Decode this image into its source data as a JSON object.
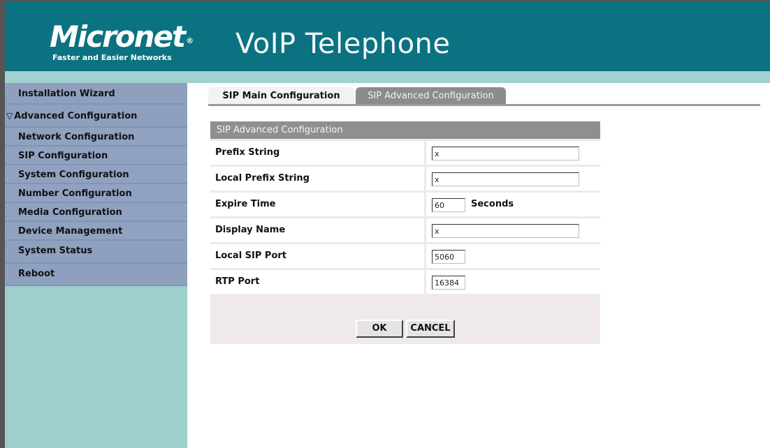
{
  "header": {
    "logo_text": "Micronet",
    "logo_tm": "®",
    "logo_tagline": "Faster and Easier Networks",
    "app_title": "VoIP Telephone"
  },
  "sidebar": {
    "items": [
      {
        "label": "Installation Wizard"
      },
      {
        "label": "Advanced Configuration",
        "expanded": true,
        "icon": "triangle-down-icon"
      },
      {
        "label": "Network Configuration"
      },
      {
        "label": "SIP Configuration"
      },
      {
        "label": "System Configuration"
      },
      {
        "label": "Number Configuration"
      },
      {
        "label": "Media Configuration"
      },
      {
        "label": "Device Management"
      },
      {
        "label": "System Status"
      },
      {
        "label": "Reboot"
      }
    ]
  },
  "tabs": [
    {
      "label": "SIP Main Configuration",
      "active": true
    },
    {
      "label": "SIP Advanced Configuration",
      "active": false
    }
  ],
  "panel": {
    "title": "SIP Advanced Configuration",
    "rows": [
      {
        "label": "Prefix String",
        "value": "x"
      },
      {
        "label": "Local Prefix String",
        "value": "x"
      },
      {
        "label": "Expire Time",
        "value": "60",
        "unit": "Seconds"
      },
      {
        "label": "Display Name",
        "value": "x"
      },
      {
        "label": "Local SIP Port",
        "value": "5060"
      },
      {
        "label": "RTP Port",
        "value": "16384"
      }
    ],
    "ok_label": "OK",
    "cancel_label": "CANCEL"
  },
  "colors": {
    "header_bg": "#0b7281",
    "strip_bg": "#a0d1cd",
    "sidebar_bg": "#9fcfcc",
    "sidebar_item_bg": "#8fa0bf",
    "panel_bg": "#efe8ec",
    "panel_head_bg": "#8e8f8f"
  }
}
